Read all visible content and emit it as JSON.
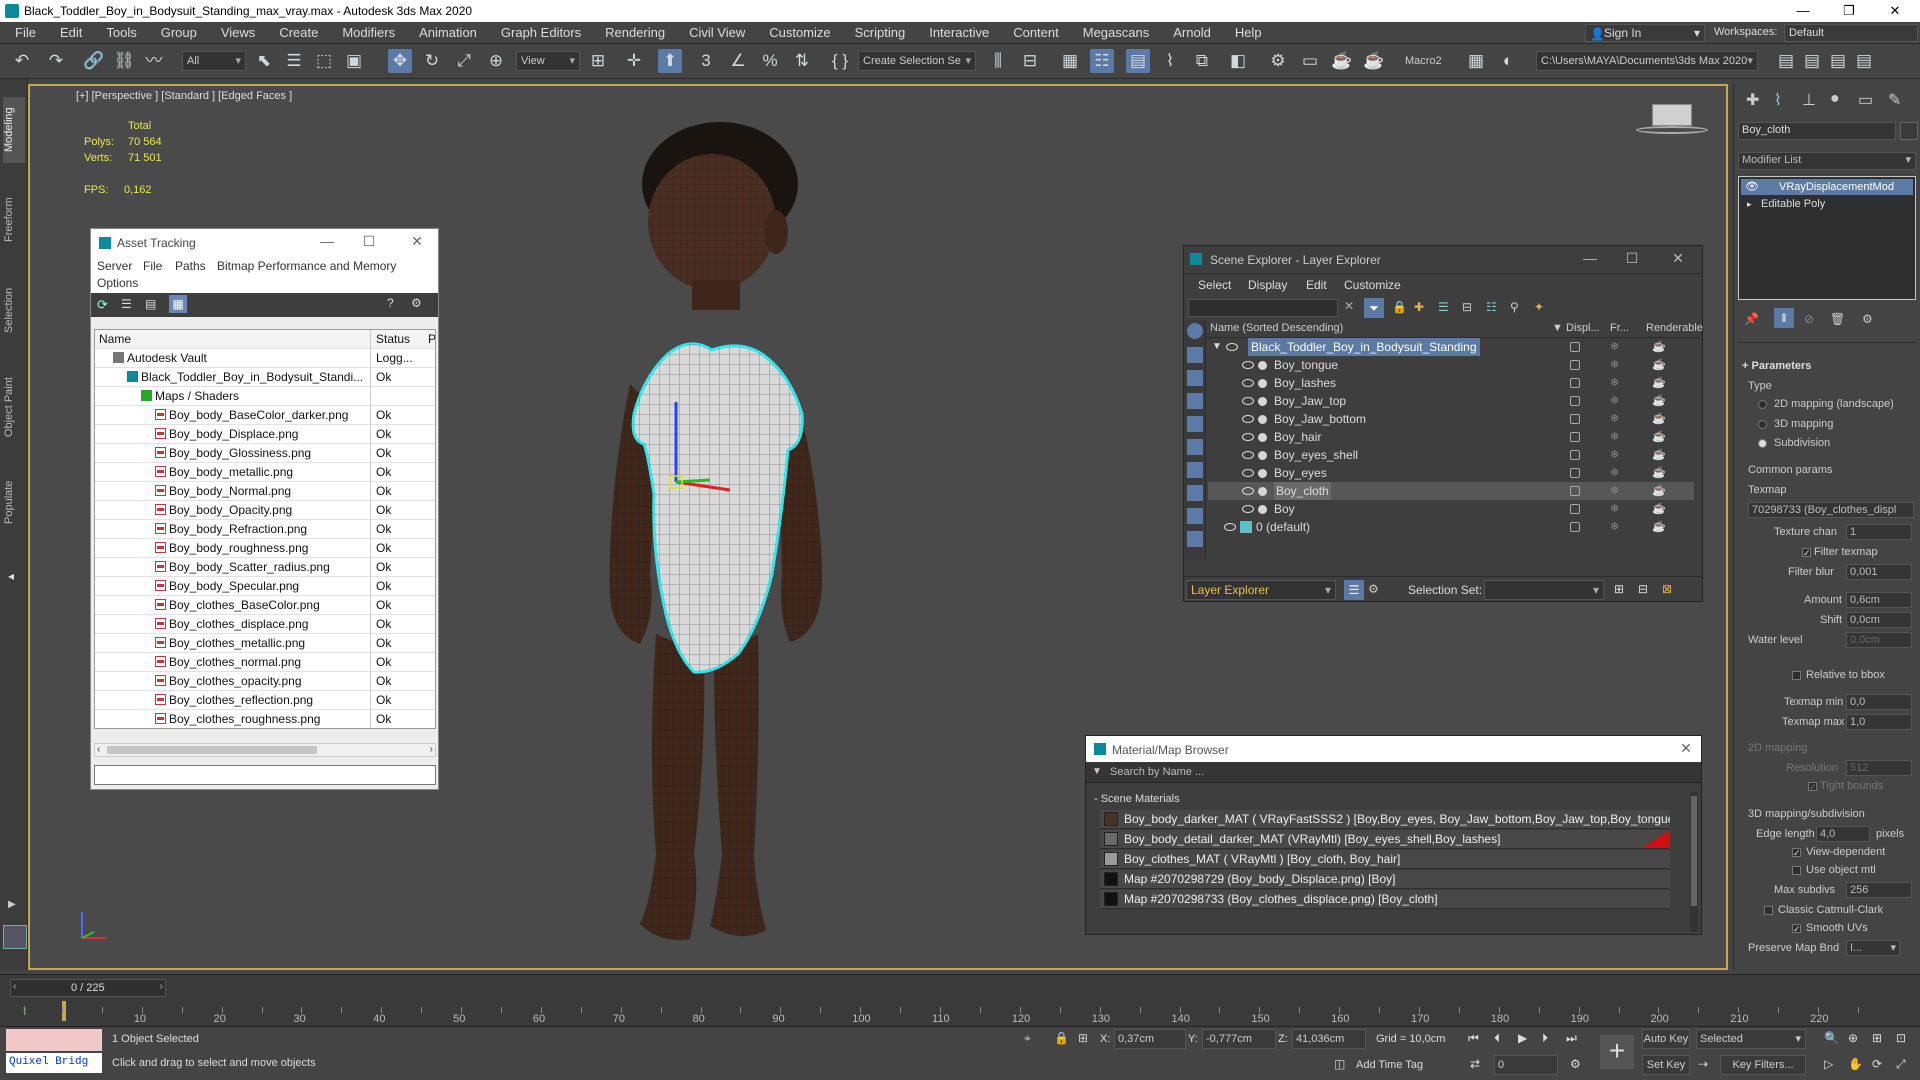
{
  "window": {
    "title": "Black_Toddler_Boy_in_Bodysuit_Standing_max_vray.max - Autodesk 3ds Max 2020"
  },
  "menu": [
    "File",
    "Edit",
    "Tools",
    "Group",
    "Views",
    "Create",
    "Modifiers",
    "Animation",
    "Graph Editors",
    "Rendering",
    "Civil View",
    "Customize",
    "Scripting",
    "Interactive",
    "Content",
    "Megascans",
    "Arnold",
    "Help"
  ],
  "account": {
    "signin": "Sign In",
    "workspaces_label": "Workspaces:",
    "workspace": "Default"
  },
  "toolbar": {
    "filter": "All",
    "refcoord": "View",
    "selection_set": "Create Selection Se",
    "macro": "Macro2",
    "project_path": "C:\\Users\\MAYA\\Documents\\3ds Max 2020"
  },
  "ribbon_tabs": [
    "Modeling",
    "Freeform",
    "Selection",
    "Object Paint",
    "Populate"
  ],
  "viewport": {
    "label": "[+] [Perspective ] [Standard ] [Edged Faces ]",
    "stats": {
      "total_label": "Total",
      "polys_label": "Polys:",
      "polys": "70 564",
      "verts_label": "Verts:",
      "verts": "71 501",
      "fps_label": "FPS:",
      "fps": "0,162"
    }
  },
  "asset_tracking": {
    "title": "Asset Tracking",
    "menu": [
      "Server",
      "File",
      "Paths",
      "Bitmap Performance and Memory",
      "Options"
    ],
    "columns": [
      "Name",
      "Status",
      "P"
    ],
    "rows": [
      {
        "name": "Autodesk Vault",
        "status": "Logg...",
        "indent": 1,
        "icon": "vault"
      },
      {
        "name": "Black_Toddler_Boy_in_Bodysuit_Standi...",
        "status": "Ok",
        "indent": 2,
        "icon": "max"
      },
      {
        "name": "Maps / Shaders",
        "status": "",
        "indent": 3,
        "icon": "maps"
      },
      {
        "name": "Boy_body_BaseColor_darker.png",
        "status": "Ok",
        "indent": 4,
        "icon": "png"
      },
      {
        "name": "Boy_body_Displace.png",
        "status": "Ok",
        "indent": 4,
        "icon": "png"
      },
      {
        "name": "Boy_body_Glossiness.png",
        "status": "Ok",
        "indent": 4,
        "icon": "png"
      },
      {
        "name": "Boy_body_metallic.png",
        "status": "Ok",
        "indent": 4,
        "icon": "png"
      },
      {
        "name": "Boy_body_Normal.png",
        "status": "Ok",
        "indent": 4,
        "icon": "png"
      },
      {
        "name": "Boy_body_Opacity.png",
        "status": "Ok",
        "indent": 4,
        "icon": "png"
      },
      {
        "name": "Boy_body_Refraction.png",
        "status": "Ok",
        "indent": 4,
        "icon": "png"
      },
      {
        "name": "Boy_body_roughness.png",
        "status": "Ok",
        "indent": 4,
        "icon": "png"
      },
      {
        "name": "Boy_body_Scatter_radius.png",
        "status": "Ok",
        "indent": 4,
        "icon": "png"
      },
      {
        "name": "Boy_body_Specular.png",
        "status": "Ok",
        "indent": 4,
        "icon": "png"
      },
      {
        "name": "Boy_clothes_BaseColor.png",
        "status": "Ok",
        "indent": 4,
        "icon": "png"
      },
      {
        "name": "Boy_clothes_displace.png",
        "status": "Ok",
        "indent": 4,
        "icon": "png"
      },
      {
        "name": "Boy_clothes_metallic.png",
        "status": "Ok",
        "indent": 4,
        "icon": "png"
      },
      {
        "name": "Boy_clothes_normal.png",
        "status": "Ok",
        "indent": 4,
        "icon": "png"
      },
      {
        "name": "Boy_clothes_opacity.png",
        "status": "Ok",
        "indent": 4,
        "icon": "png"
      },
      {
        "name": "Boy_clothes_reflection.png",
        "status": "Ok",
        "indent": 4,
        "icon": "png"
      },
      {
        "name": "Boy_clothes_roughness.png",
        "status": "Ok",
        "indent": 4,
        "icon": "png"
      }
    ]
  },
  "scene_explorer": {
    "title": "Scene Explorer - Layer Explorer",
    "menu": [
      "Select",
      "Display",
      "Edit",
      "Customize"
    ],
    "columns": [
      "Name (Sorted Descending)",
      "Displ...",
      "Fr...",
      "Renderable"
    ],
    "root": "Black_Toddler_Boy_in_Bodysuit_Standing",
    "items": [
      "Boy_tongue",
      "Boy_lashes",
      "Boy_Jaw_top",
      "Boy_Jaw_bottom",
      "Boy_hair",
      "Boy_eyes_shell",
      "Boy_eyes",
      "Boy_cloth",
      "Boy"
    ],
    "selected_item": "Boy_cloth",
    "default_layer": "0 (default)",
    "footer_explorer": "Layer Explorer",
    "footer_selection_label": "Selection Set:"
  },
  "material_browser": {
    "title": "Material/Map Browser",
    "search_placeholder": "Search by Name ...",
    "group": "- Scene Materials",
    "items": [
      {
        "label": "Boy_body_darker_MAT ( VRayFastSSS2 ) [Boy,Boy_eyes, Boy_Jaw_bottom,Boy_Jaw_top,Boy_tongue]",
        "swatch": "#4a3326"
      },
      {
        "label": "Boy_body_detail_darker_MAT (VRayMtl) [Boy_eyes_shell,Boy_lashes]",
        "swatch": "#6a6a6a"
      },
      {
        "label": "Boy_clothes_MAT ( VRayMtl ) [Boy_cloth, Boy_hair]",
        "swatch": "#9a9a9a"
      },
      {
        "label": "Map #2070298729 (Boy_body_Displace.png) [Boy]",
        "swatch": "#111111"
      },
      {
        "label": "Map #2070298733 (Boy_clothes_displace.png) [Boy_cloth]",
        "swatch": "#111111"
      }
    ]
  },
  "command_panel": {
    "object_name": "Boy_cloth",
    "modifier_list": "Modifier List",
    "stack": [
      "VRayDisplacementMod",
      "Editable Poly"
    ],
    "rollout": "Parameters",
    "type_label": "Type",
    "types": [
      "2D mapping (landscape)",
      "3D mapping",
      "Subdivision"
    ],
    "common_params": "Common params",
    "texmap_label": "Texmap",
    "texmap": "70298733 (Boy_clothes_displ",
    "texture_chan_label": "Texture chan",
    "texture_chan": "1",
    "filter_texmap": "Filter texmap",
    "filter_blur_label": "Filter blur",
    "filter_blur": "0,001",
    "amount_label": "Amount",
    "amount": "0,6cm",
    "shift_label": "Shift",
    "shift": "0,0cm",
    "water_level_label": "Water level",
    "water_level": "0,0cm",
    "relative_bbox": "Relative to bbox",
    "texmap_min_label": "Texmap min",
    "texmap_min": "0,0",
    "texmap_max_label": "Texmap max",
    "texmap_max": "1,0",
    "mapping2d": "2D mapping",
    "resolution_label": "Resolution",
    "resolution": "512",
    "tight_bounds": "Tight bounds",
    "mapping3d": "3D mapping/subdivision",
    "edge_length_label": "Edge length",
    "edge_length": "4,0",
    "pixels": "pixels",
    "view_dependent": "View-dependent",
    "use_object_mtl": "Use object mtl",
    "max_subdivs_label": "Max subdivs",
    "max_subdivs": "256",
    "classic_catmull": "Classic Catmull-Clark",
    "smooth_uvs": "Smooth UVs",
    "preserve_label": "Preserve Map Bnd",
    "preserve": "I..."
  },
  "timeline": {
    "frame": "0 / 225",
    "ticks": [
      "10",
      "20",
      "30",
      "40",
      "50",
      "60",
      "70",
      "80",
      "90",
      "100",
      "110",
      "120",
      "130",
      "140",
      "150",
      "160",
      "170",
      "180",
      "190",
      "200",
      "210",
      "220"
    ]
  },
  "status": {
    "quixel": "Quixel Bridg",
    "selected": "1 Object Selected",
    "prompt": "Click and drag to select and move objects",
    "x_label": "X:",
    "x": "0,37cm",
    "y_label": "Y:",
    "y": "-0,777cm",
    "z_label": "Z:",
    "z": "41,036cm",
    "grid": "Grid = 10,0cm",
    "add_time_tag": "Add Time Tag",
    "auto_key": "Auto Key",
    "set_key": "Set Key",
    "key_mode": "Selected",
    "key_filters": "Key Filters...",
    "frame_field": "0"
  }
}
